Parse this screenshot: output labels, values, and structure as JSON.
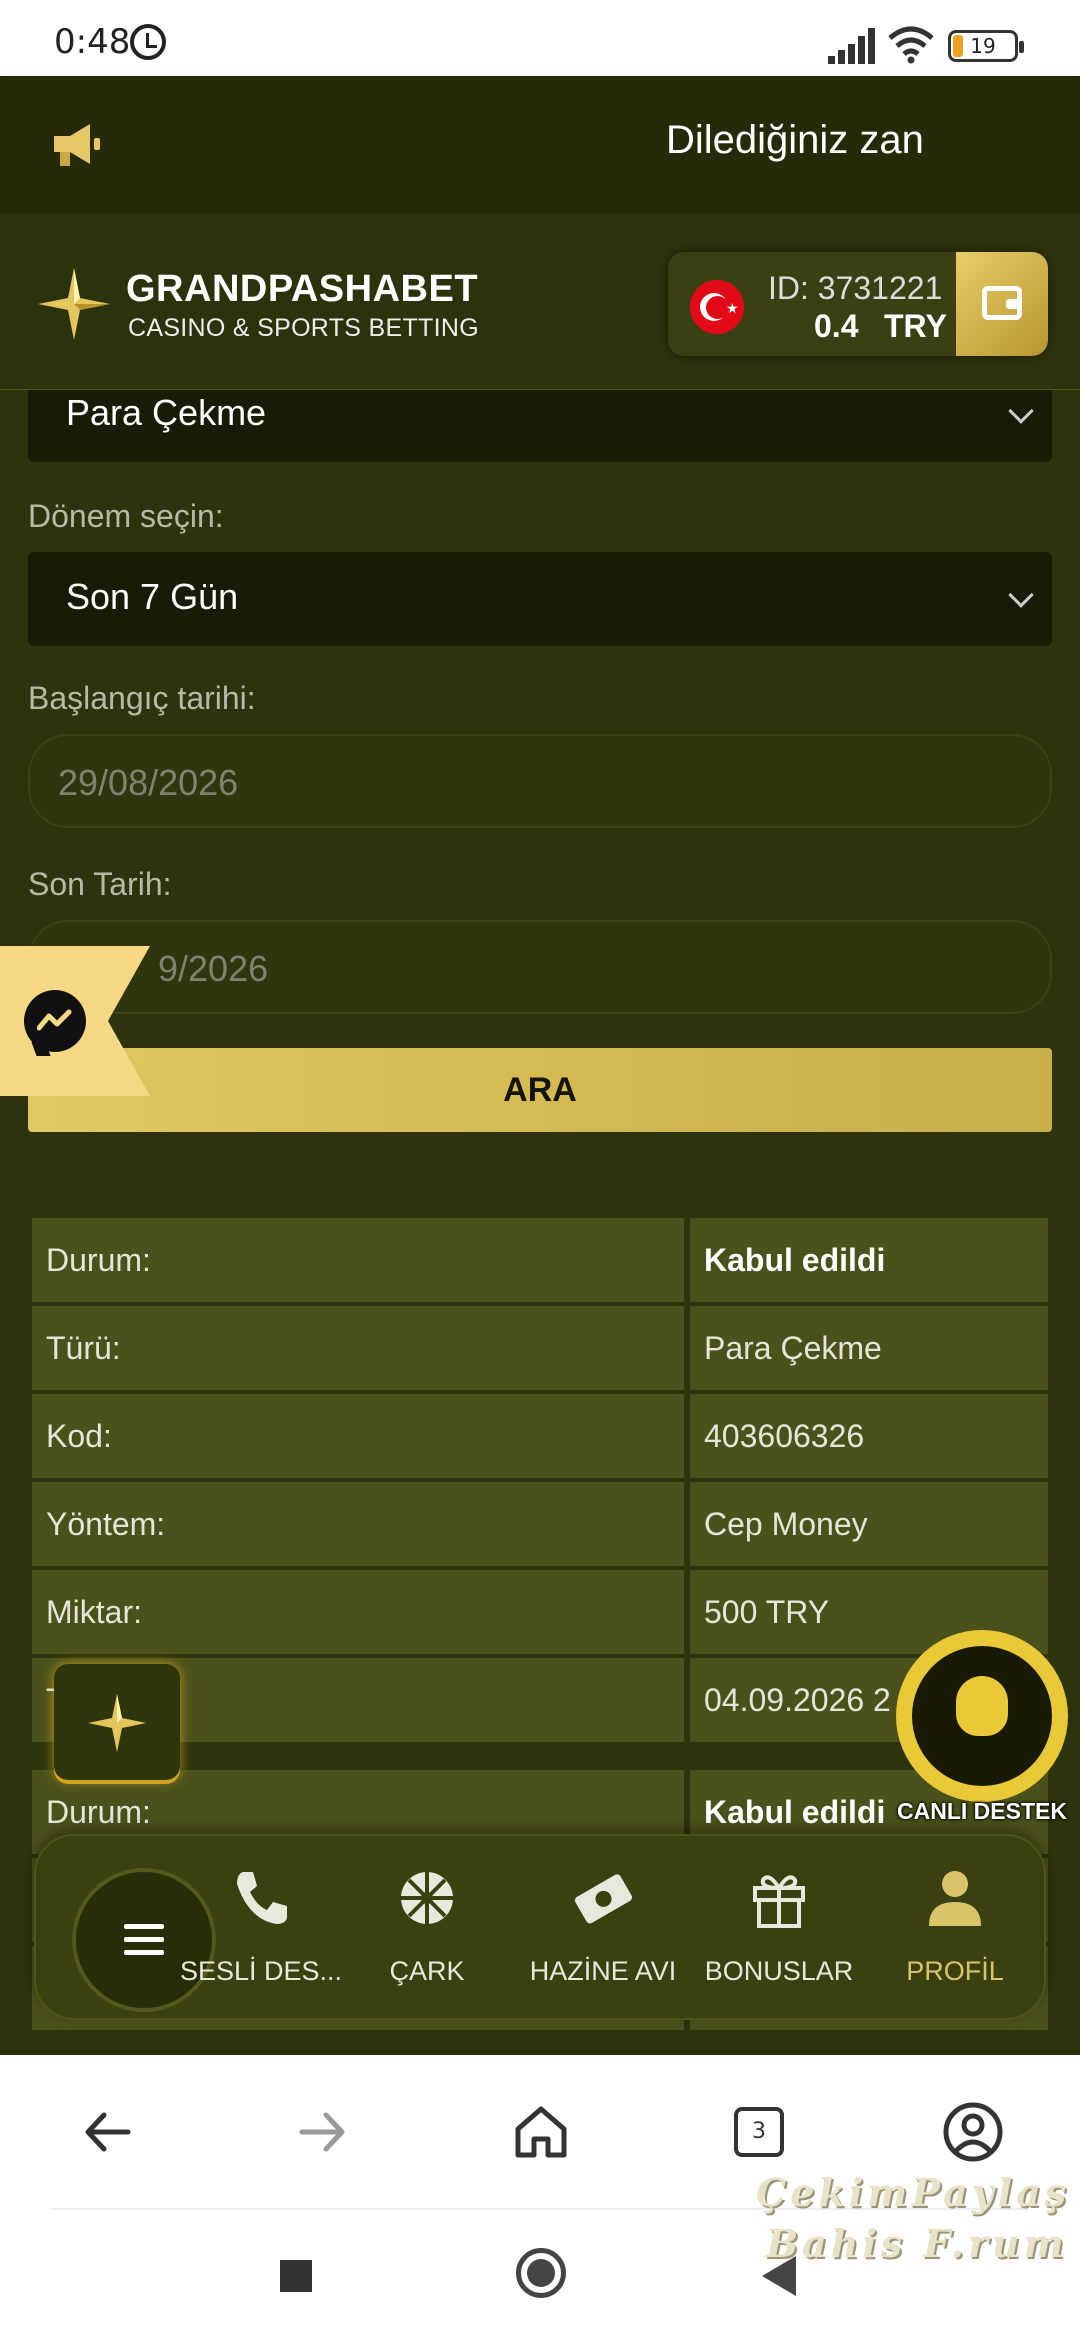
{
  "status_bar": {
    "time": "0:48",
    "battery": "19"
  },
  "announcement": {
    "text": "Dilediğiniz zan"
  },
  "header": {
    "brand": "GRANDPASHABET",
    "tagline": "CASINO & SPORTS BETTING",
    "user_id": "ID: 3731221",
    "balance": "0.4",
    "currency": "TRY"
  },
  "filters": {
    "type_value": "Para Çekme",
    "period_label": "Dönem seçin:",
    "period_value": "Son 7 Gün",
    "start_label": "Başlangıç tarihi:",
    "start_value": "29/08/2026",
    "end_label": "Son Tarih:",
    "end_value": "9/2026",
    "search_button": "ARA"
  },
  "transactions": [
    {
      "rows": [
        {
          "key": "Durum:",
          "value": "Kabul edildi"
        },
        {
          "key": "Türü:",
          "value": "Para Çekme"
        },
        {
          "key": "Kod:",
          "value": "403606326"
        },
        {
          "key": "Yöntem:",
          "value": "Cep Money"
        },
        {
          "key": "Miktar:",
          "value": "500 TRY"
        },
        {
          "key": "T",
          "value": "04.09.2026 2"
        }
      ]
    },
    {
      "rows": [
        {
          "key": "Durum:",
          "value": "Kabul edildi"
        }
      ]
    }
  ],
  "live_support": {
    "label": "CANLI DESTEK"
  },
  "bottom_nav": {
    "items": [
      {
        "label": "SESLİ DES...",
        "icon": "phone-icon"
      },
      {
        "label": "ÇARK",
        "icon": "wheel-icon"
      },
      {
        "label": "HAZİNE AVI",
        "icon": "money-icon"
      },
      {
        "label": "BONUSLAR",
        "icon": "gift-icon"
      },
      {
        "label": "PROFİL",
        "icon": "profile-icon"
      }
    ]
  },
  "browser": {
    "tab_count": "3"
  },
  "watermark": {
    "line1": "ÇekimPaylaş",
    "line2": "Bahis F.rum"
  },
  "colors": {
    "accent": "#d9c46a",
    "background": "#2c320b",
    "gold": "#e2c760"
  }
}
